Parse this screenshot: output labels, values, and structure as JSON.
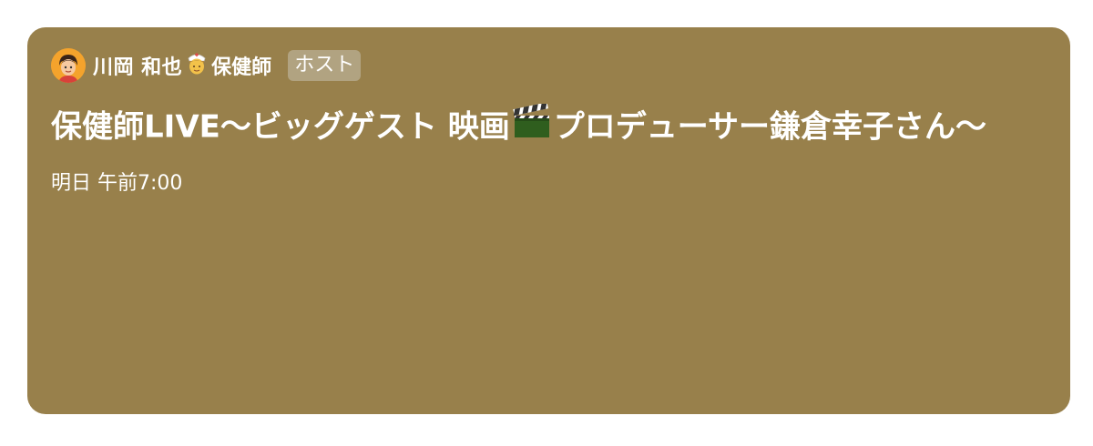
{
  "event_card": {
    "host": {
      "name": "川岡 和也",
      "role": "保健師",
      "badge": "ホスト",
      "avatar_icon": "person-avatar-icon",
      "role_icon": "health-worker-emoji-icon"
    },
    "title_part1": "保健師LIVE〜ビッグゲスト 映画",
    "title_icon": "clapper-board-icon",
    "title_part2": "プロデューサー鎌倉幸子さん〜",
    "time": "明日 午前7:00",
    "background_color": "#98804b"
  }
}
